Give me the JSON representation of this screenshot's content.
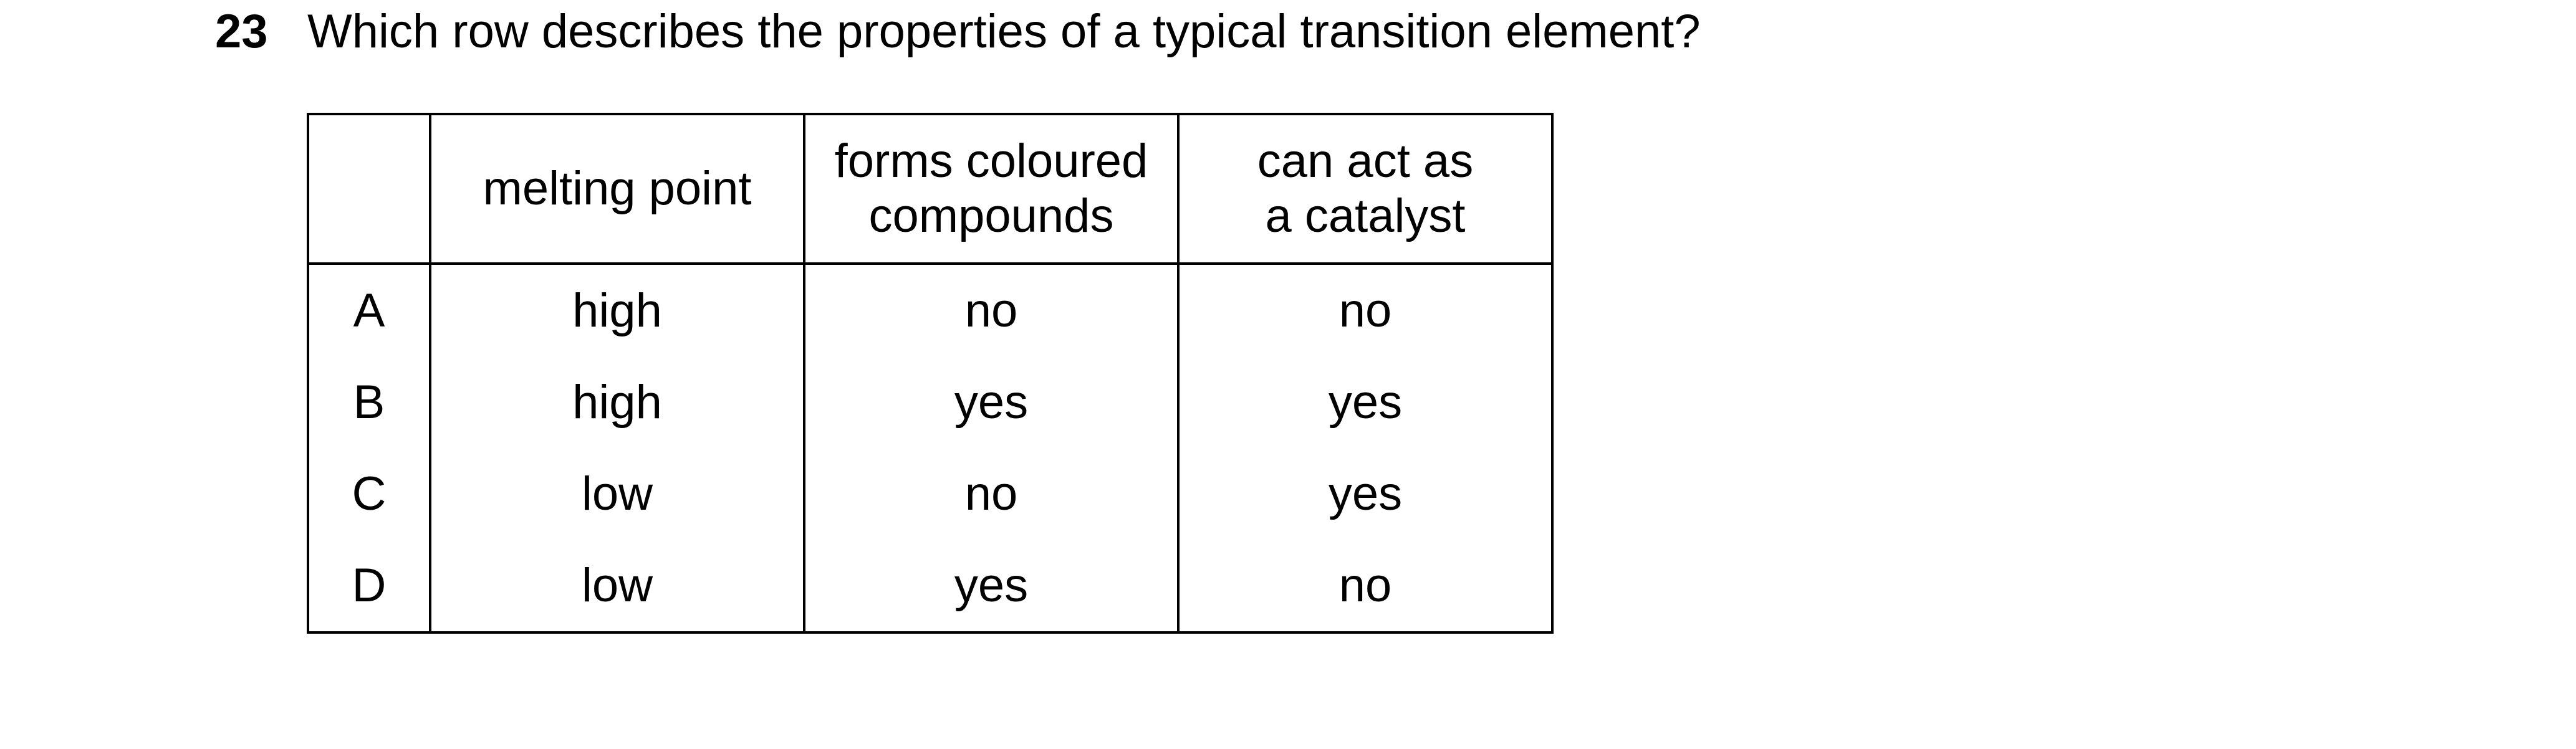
{
  "question": {
    "number": "23",
    "text": "Which row describes the properties of a typical transition element?"
  },
  "table": {
    "headers": [
      {
        "lines": [
          ""
        ]
      },
      {
        "lines": [
          "melting point"
        ]
      },
      {
        "lines": [
          "forms coloured",
          "compounds"
        ]
      },
      {
        "lines": [
          "can act as",
          "a catalyst"
        ]
      }
    ],
    "rows": [
      {
        "key": "A",
        "melting_point": "high",
        "coloured_compounds": "no",
        "catalyst": "no"
      },
      {
        "key": "B",
        "melting_point": "high",
        "coloured_compounds": "yes",
        "catalyst": "yes"
      },
      {
        "key": "C",
        "melting_point": "low",
        "coloured_compounds": "no",
        "catalyst": "yes"
      },
      {
        "key": "D",
        "melting_point": "low",
        "coloured_compounds": "yes",
        "catalyst": "no"
      }
    ]
  }
}
